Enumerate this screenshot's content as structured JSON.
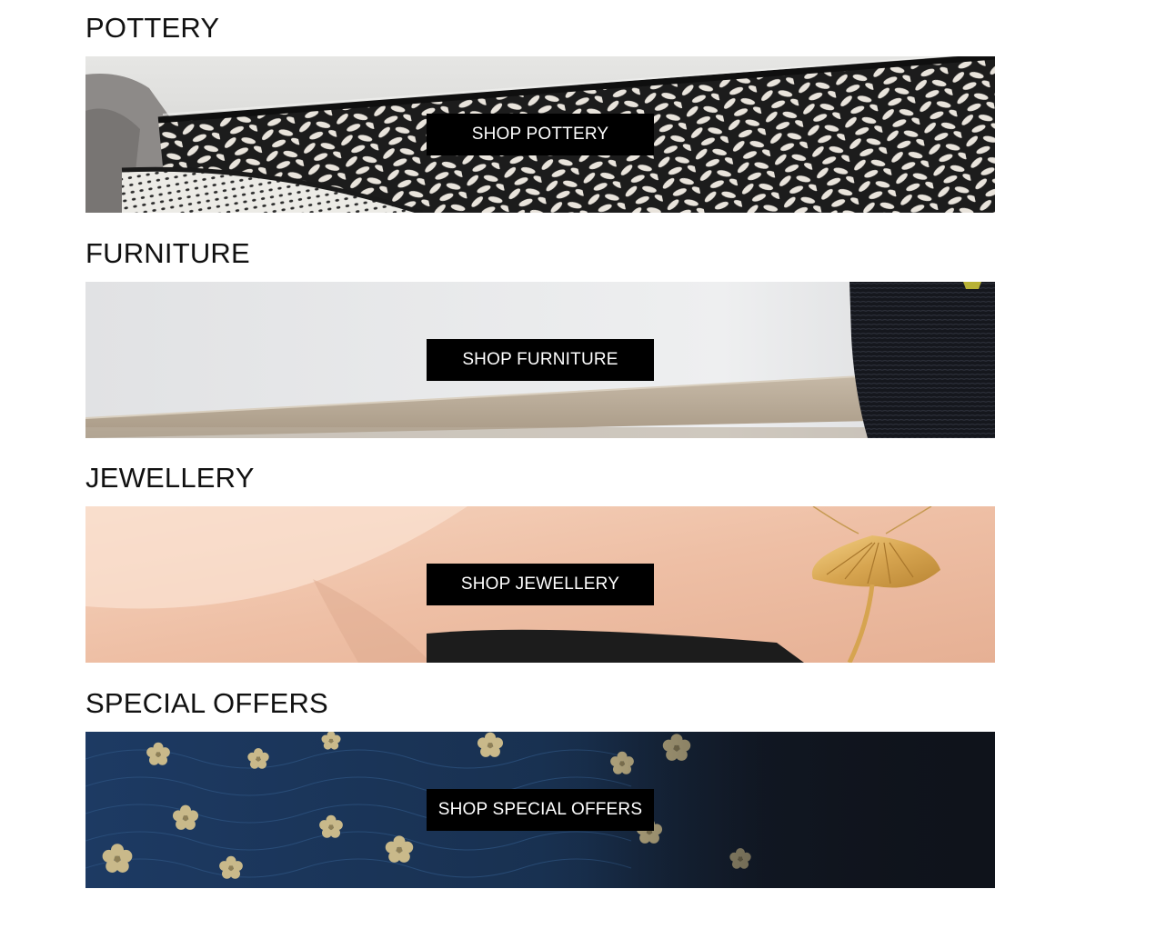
{
  "sections": [
    {
      "title": "POTTERY",
      "button_label": "SHOP POTTERY",
      "image": "pottery-bowl-leaf-pattern"
    },
    {
      "title": "FURNITURE",
      "button_label": "SHOP FURNITURE",
      "image": "wooden-shelf-with-black-vase"
    },
    {
      "title": "JEWELLERY",
      "button_label": "SHOP JEWELLERY",
      "image": "gold-ginkgo-leaf-pendant"
    },
    {
      "title": "SPECIAL OFFERS",
      "button_label": "SHOP SPECIAL OFFERS",
      "image": "blue-fabric-gold-blossoms"
    }
  ],
  "colors": {
    "button_bg": "#000000",
    "button_text": "#ffffff",
    "title_text": "#111111",
    "page_bg": "#ffffff"
  }
}
